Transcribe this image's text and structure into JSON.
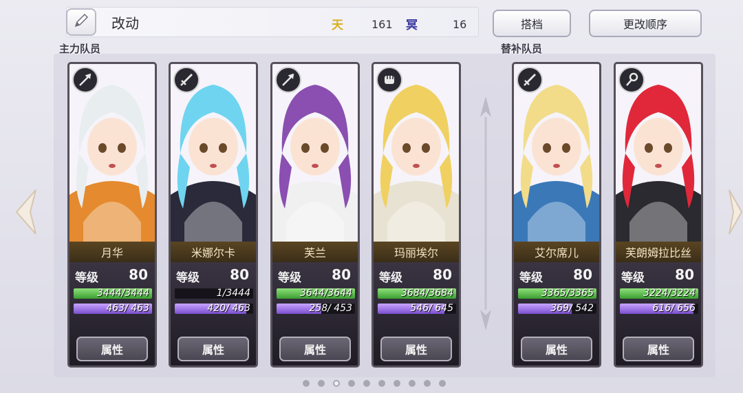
{
  "header": {
    "team_name": "改动",
    "currency_heaven_icon": "天",
    "currency_heaven_value": "161",
    "currency_underworld_icon": "冥",
    "currency_underworld_value": "16",
    "partner_button": "搭档",
    "reorder_button": "更改顺序"
  },
  "sections": {
    "main": "主力队员",
    "reserve": "替补队员"
  },
  "characters": [
    {
      "name": "月华",
      "class_icon": "spear-icon",
      "level_label": "等级",
      "level": "80",
      "hp": "3444/3444",
      "hp_ratio": 1.0,
      "mp": "463/ 463",
      "mp_ratio": 1.0,
      "attr_button": "属性",
      "hair": "#e8eef0",
      "accent": "#e58a2e"
    },
    {
      "name": "米娜尔卡",
      "class_icon": "sword-icon",
      "level_label": "等级",
      "level": "80",
      "hp": "1/3444",
      "hp_ratio": 0.0,
      "mp": "420/ 463",
      "mp_ratio": 0.91,
      "attr_button": "属性",
      "hair": "#6fd4f0",
      "accent": "#2a2a3a"
    },
    {
      "name": "芙兰",
      "class_icon": "spear-icon",
      "level_label": "等级",
      "level": "80",
      "hp": "3644/3644",
      "hp_ratio": 1.0,
      "mp": "258/ 453",
      "mp_ratio": 0.57,
      "attr_button": "属性",
      "hair": "#8a4fb0",
      "accent": "#f0f0f0"
    },
    {
      "name": "玛丽埃尔",
      "class_icon": "fist-icon",
      "level_label": "等级",
      "level": "80",
      "hp": "3684/3684",
      "hp_ratio": 1.0,
      "mp": "546/ 645",
      "mp_ratio": 0.85,
      "attr_button": "属性",
      "hair": "#f0d060",
      "accent": "#e8e2d2"
    },
    {
      "name": "艾尔席儿",
      "class_icon": "sword-icon",
      "level_label": "等级",
      "level": "80",
      "hp": "3365/3365",
      "hp_ratio": 1.0,
      "mp": "369/ 542",
      "mp_ratio": 0.68,
      "attr_button": "属性",
      "hair": "#f2dc8a",
      "accent": "#3a78b8"
    },
    {
      "name": "芙朗姆拉比丝",
      "class_icon": "staff-icon",
      "level_label": "等级",
      "level": "80",
      "hp": "3224/3224",
      "hp_ratio": 1.0,
      "mp": "616/ 656",
      "mp_ratio": 0.94,
      "attr_button": "属性",
      "hair": "#e0283a",
      "accent": "#2a2a30"
    }
  ],
  "pagination": {
    "total": 10,
    "active": 3
  },
  "colors": {
    "hp": "#3a9e31",
    "mp": "#7b4fd0",
    "currency_heaven": "#d8b020",
    "currency_underworld": "#3a3aa0"
  }
}
